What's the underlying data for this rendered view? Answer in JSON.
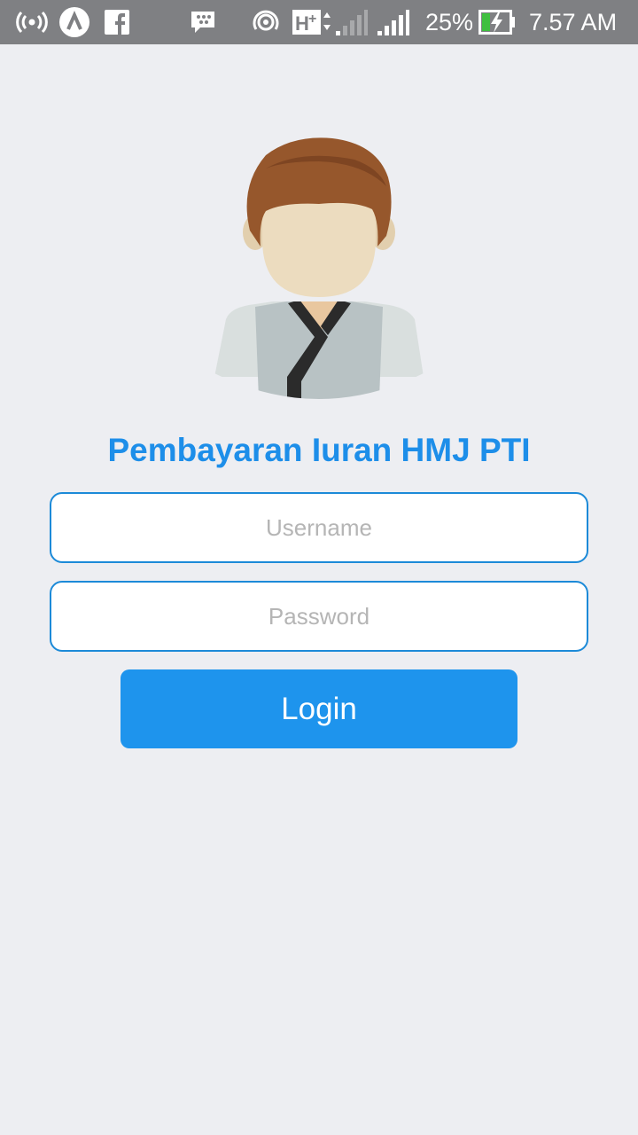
{
  "status_bar": {
    "network_type": "H+",
    "battery_percent": "25%",
    "time": "7.57 AM",
    "icons": [
      "hotspot-icon",
      "app-a-icon",
      "facebook-icon",
      "bbm-icon",
      "wifi-hotspot-icon",
      "network-type-icon",
      "signal-icon-1",
      "signal-icon-2",
      "battery-charging-icon"
    ]
  },
  "app": {
    "title": "Pembayaran Iuran HMJ PTI",
    "username_placeholder": "Username",
    "password_placeholder": "Password",
    "login_label": "Login"
  },
  "colors": {
    "accent": "#1e94ed",
    "title": "#1d8ee9",
    "background": "#edeef2",
    "status_bar": "#7f8083"
  }
}
